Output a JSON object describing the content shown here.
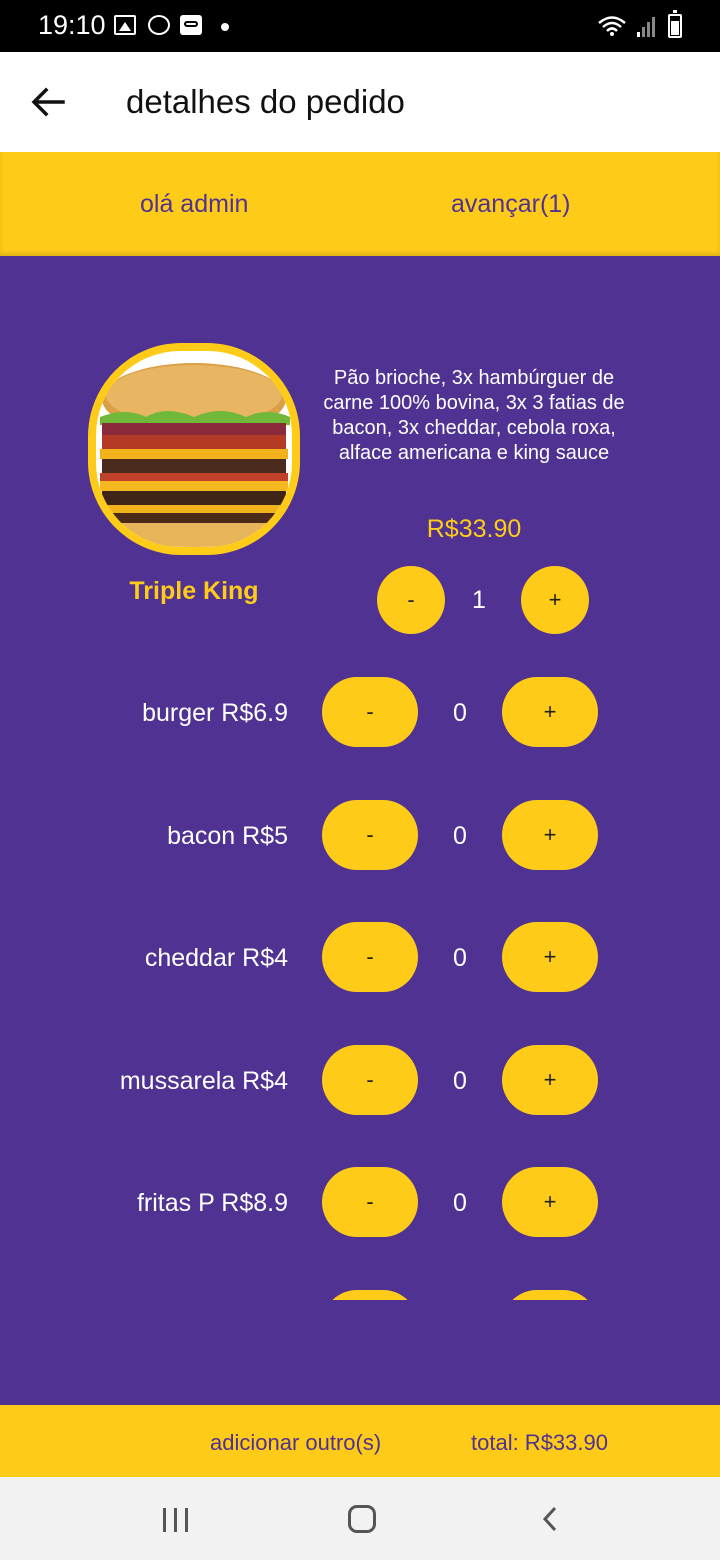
{
  "status_bar": {
    "time": "19:10",
    "icons": [
      "gallery-icon",
      "whatsapp-icon",
      "voicemail-icon",
      "dot-icon",
      "wifi-icon",
      "signal-icon",
      "battery-icon"
    ]
  },
  "app_bar": {
    "title": "detalhes do pedido",
    "back_icon": "arrow-left-icon"
  },
  "header": {
    "greeting": "olá admin",
    "advance": "avançar(1)"
  },
  "product": {
    "name": "Triple King",
    "description": "Pão brioche, 3x hambúrguer de carne 100% bovina, 3x 3 fatias de bacon, 3x cheddar, cebola roxa, alface americana e king sauce",
    "price": "R$33.90",
    "quantity": "1",
    "minus": "-",
    "plus": "+"
  },
  "extras": [
    {
      "label": "burger R$6.9",
      "quantity": "0",
      "minus": "-",
      "plus": "+"
    },
    {
      "label": "bacon R$5",
      "quantity": "0",
      "minus": "-",
      "plus": "+"
    },
    {
      "label": "cheddar R$4",
      "quantity": "0",
      "minus": "-",
      "plus": "+"
    },
    {
      "label": "mussarela R$4",
      "quantity": "0",
      "minus": "-",
      "plus": "+"
    },
    {
      "label": "fritas P R$8.9",
      "quantity": "0",
      "minus": "-",
      "plus": "+"
    }
  ],
  "footer": {
    "add_other": "adicionar outro(s)",
    "total": "total: R$33.90"
  },
  "colors": {
    "primary": "#4f3291",
    "accent": "#fecc18"
  },
  "nav_bar": {
    "icons": [
      "recents-icon",
      "home-icon",
      "back-icon"
    ]
  }
}
